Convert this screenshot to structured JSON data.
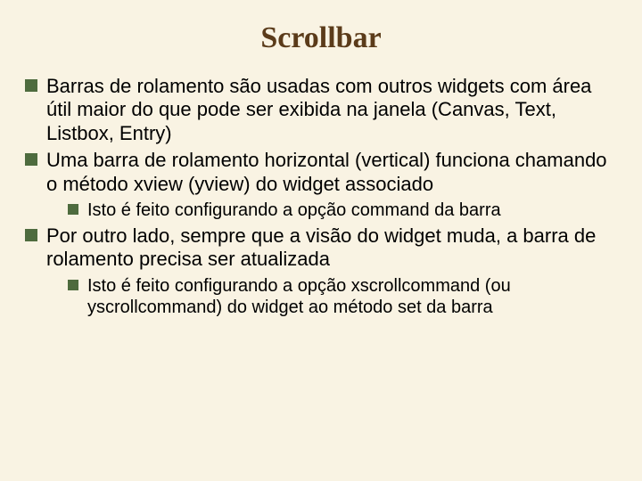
{
  "title": "Scrollbar",
  "bullets": [
    {
      "text": "Barras de rolamento são usadas com outros widgets com área útil maior do que pode ser exibida na janela (Canvas, Text, Listbox, Entry)"
    },
    {
      "text": "Uma barra de rolamento horizontal (vertical) funciona chamando o método xview (yview) do widget associado",
      "children": [
        {
          "text": "Isto é feito configurando a opção command da barra"
        }
      ]
    },
    {
      "text": "Por outro lado, sempre que a visão do widget muda, a barra de rolamento precisa ser atualizada",
      "children": [
        {
          "text": "Isto é feito configurando a opção xscrollcommand (ou yscrollcommand) do widget ao método set da barra"
        }
      ]
    }
  ]
}
